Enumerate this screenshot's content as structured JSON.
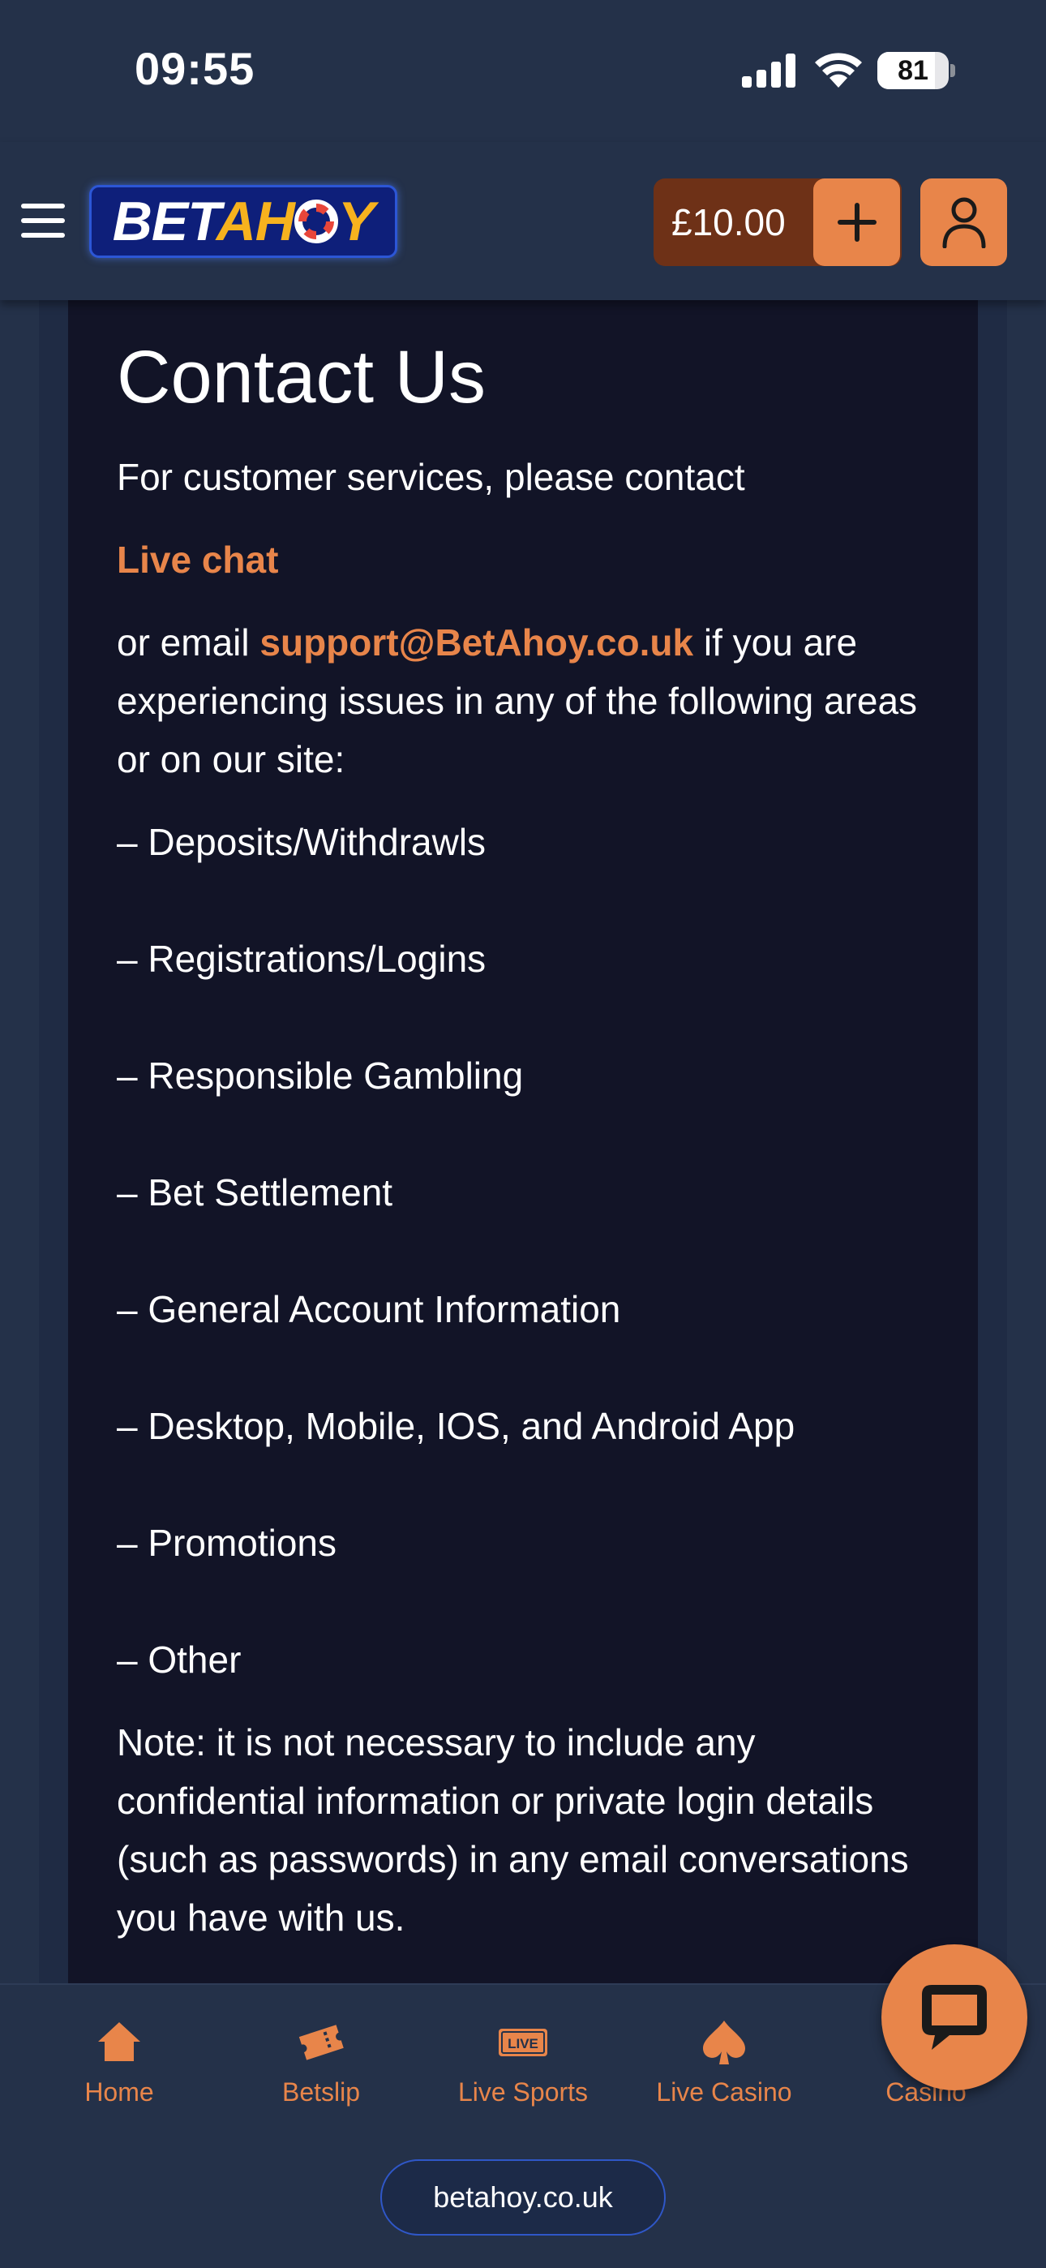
{
  "status_bar": {
    "time": "09:55",
    "battery": "81",
    "battery_level_percent": 81,
    "icons": [
      "signal-icon",
      "wifi-icon",
      "battery-icon"
    ]
  },
  "header": {
    "logo": {
      "part1": "BET",
      "part2": "AH",
      "part3": "Y"
    },
    "balance": "£10.00",
    "icons": [
      "menu-icon",
      "plus-icon",
      "user-icon"
    ]
  },
  "content": {
    "title": "Contact Us",
    "intro": "For customer services, please contact",
    "live_chat": "Live chat",
    "email_prefix": "or email ",
    "email": "support@BetAhoy.co.uk",
    "email_suffix": " if you are experiencing issues in any of the following areas or on our site:",
    "list": [
      "– Deposits/Withdrawls",
      "– Registrations/Logins",
      "– Responsible Gambling",
      "– Bet Settlement",
      "– General Account Information",
      "– Desktop, Mobile, IOS, and Android App",
      "– Promotions",
      "– Other"
    ],
    "note": "Note: it is not necessary to include any confidential information or private login details (such as passwords) in any email conversations you have with us."
  },
  "bottom_nav": {
    "items": [
      {
        "label": "Home",
        "icon": "home-icon"
      },
      {
        "label": "Betslip",
        "icon": "ticket-icon"
      },
      {
        "label": "Live Sports",
        "icon": "live-badge-icon",
        "badge": "LIVE"
      },
      {
        "label": "Live Casino",
        "icon": "spade-icon"
      },
      {
        "label": "Casino",
        "icon": "casino-icon"
      }
    ]
  },
  "site_url": "betahoy.co.uk",
  "colors": {
    "background": "#243149",
    "card": "#121427",
    "accent": "#e8854a",
    "balance_pill": "#6e3117",
    "logo_yellow": "#f7b21e",
    "logo_blue": "#0e1f7a"
  }
}
